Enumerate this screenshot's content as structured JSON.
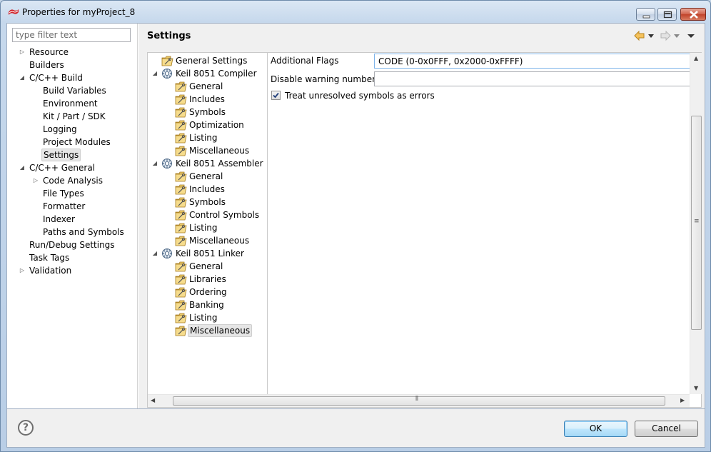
{
  "window": {
    "title": "Properties for myProject_8"
  },
  "filter": {
    "placeholder": "type filter text"
  },
  "left_tree": [
    {
      "label": "Resource",
      "level": 0,
      "twisty": "collapsed"
    },
    {
      "label": "Builders",
      "level": 0,
      "twisty": "none"
    },
    {
      "label": "C/C++ Build",
      "level": 0,
      "twisty": "expanded"
    },
    {
      "label": "Build Variables",
      "level": 1,
      "twisty": "none"
    },
    {
      "label": "Environment",
      "level": 1,
      "twisty": "none"
    },
    {
      "label": "Kit / Part / SDK",
      "level": 1,
      "twisty": "none"
    },
    {
      "label": "Logging",
      "level": 1,
      "twisty": "none"
    },
    {
      "label": "Project Modules",
      "level": 1,
      "twisty": "none"
    },
    {
      "label": "Settings",
      "level": 1,
      "twisty": "none",
      "selected": true
    },
    {
      "label": "C/C++ General",
      "level": 0,
      "twisty": "expanded"
    },
    {
      "label": "Code Analysis",
      "level": 1,
      "twisty": "collapsed"
    },
    {
      "label": "File Types",
      "level": 1,
      "twisty": "none"
    },
    {
      "label": "Formatter",
      "level": 1,
      "twisty": "none"
    },
    {
      "label": "Indexer",
      "level": 1,
      "twisty": "none"
    },
    {
      "label": "Paths and Symbols",
      "level": 1,
      "twisty": "none"
    },
    {
      "label": "Run/Debug Settings",
      "level": 0,
      "twisty": "none"
    },
    {
      "label": "Task Tags",
      "level": 0,
      "twisty": "none"
    },
    {
      "label": "Validation",
      "level": 0,
      "twisty": "collapsed"
    }
  ],
  "page": {
    "title": "Settings"
  },
  "settings_tree": [
    {
      "label": "General Settings",
      "level": 0,
      "icon": "folder",
      "twisty": "none"
    },
    {
      "label": "Keil 8051 Compiler",
      "level": 0,
      "icon": "gear",
      "twisty": "expanded"
    },
    {
      "label": "General",
      "level": 1,
      "icon": "folder"
    },
    {
      "label": "Includes",
      "level": 1,
      "icon": "folder"
    },
    {
      "label": "Symbols",
      "level": 1,
      "icon": "folder"
    },
    {
      "label": "Optimization",
      "level": 1,
      "icon": "folder"
    },
    {
      "label": "Listing",
      "level": 1,
      "icon": "folder"
    },
    {
      "label": "Miscellaneous",
      "level": 1,
      "icon": "folder"
    },
    {
      "label": "Keil 8051 Assembler",
      "level": 0,
      "icon": "gear",
      "twisty": "expanded"
    },
    {
      "label": "General",
      "level": 1,
      "icon": "folder"
    },
    {
      "label": "Includes",
      "level": 1,
      "icon": "folder"
    },
    {
      "label": "Symbols",
      "level": 1,
      "icon": "folder"
    },
    {
      "label": "Control Symbols",
      "level": 1,
      "icon": "folder"
    },
    {
      "label": "Listing",
      "level": 1,
      "icon": "folder"
    },
    {
      "label": "Miscellaneous",
      "level": 1,
      "icon": "folder"
    },
    {
      "label": "Keil 8051 Linker",
      "level": 0,
      "icon": "gear",
      "twisty": "expanded"
    },
    {
      "label": "General",
      "level": 1,
      "icon": "folder"
    },
    {
      "label": "Libraries",
      "level": 1,
      "icon": "folder"
    },
    {
      "label": "Ordering",
      "level": 1,
      "icon": "folder"
    },
    {
      "label": "Banking",
      "level": 1,
      "icon": "folder"
    },
    {
      "label": "Listing",
      "level": 1,
      "icon": "folder"
    },
    {
      "label": "Miscellaneous",
      "level": 1,
      "icon": "folder",
      "selected": true
    }
  ],
  "form": {
    "additional_flags_label": "Additional Flags",
    "additional_flags_value": "CODE (0-0x0FFF, 0x2000-0xFFFF)",
    "disable_warnings_label": "Disable warning numbers:",
    "disable_warnings_value": "",
    "treat_unresolved_label": "Treat unresolved symbols as errors",
    "treat_unresolved_checked": true
  },
  "buttons": {
    "ok": "OK",
    "cancel": "Cancel",
    "help": "?"
  },
  "colors": {
    "selection": "#e6e6e6",
    "ok_accent": "#3c7fb1",
    "close_button": "#c0432a"
  }
}
